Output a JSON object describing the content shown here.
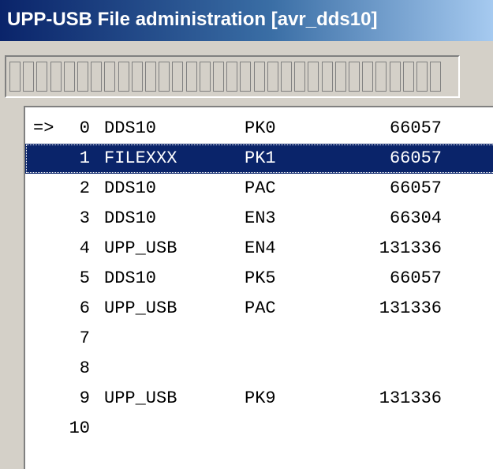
{
  "window": {
    "title": "UPP-USB File administration [avr_dds10]"
  },
  "progress": {
    "segment_count": 32,
    "filled_fraction": 0
  },
  "files": {
    "selected_index": 1,
    "current_marker": "=>",
    "rows": [
      {
        "marker": "=>",
        "num": "0",
        "name": "DDS10",
        "ext": "PK0",
        "size": "66057"
      },
      {
        "marker": "",
        "num": "1",
        "name": "FILEXXX",
        "ext": "PK1",
        "size": "66057"
      },
      {
        "marker": "",
        "num": "2",
        "name": "DDS10",
        "ext": "PAC",
        "size": "66057"
      },
      {
        "marker": "",
        "num": "3",
        "name": "DDS10",
        "ext": "EN3",
        "size": "66304"
      },
      {
        "marker": "",
        "num": "4",
        "name": "UPP_USB",
        "ext": "EN4",
        "size": "131336"
      },
      {
        "marker": "",
        "num": "5",
        "name": "DDS10",
        "ext": "PK5",
        "size": "66057"
      },
      {
        "marker": "",
        "num": "6",
        "name": "UPP_USB",
        "ext": "PAC",
        "size": "131336"
      },
      {
        "marker": "",
        "num": "7",
        "name": "",
        "ext": "",
        "size": ""
      },
      {
        "marker": "",
        "num": "8",
        "name": "",
        "ext": "",
        "size": ""
      },
      {
        "marker": "",
        "num": "9",
        "name": "UPP_USB",
        "ext": "PK9",
        "size": "131336"
      },
      {
        "marker": "",
        "num": "10",
        "name": "",
        "ext": "",
        "size": ""
      }
    ]
  },
  "colors": {
    "titlebar_start": "#0a246a",
    "titlebar_end": "#a6caf0",
    "selection": "#0a246a",
    "window_face": "#d4d0c8"
  }
}
